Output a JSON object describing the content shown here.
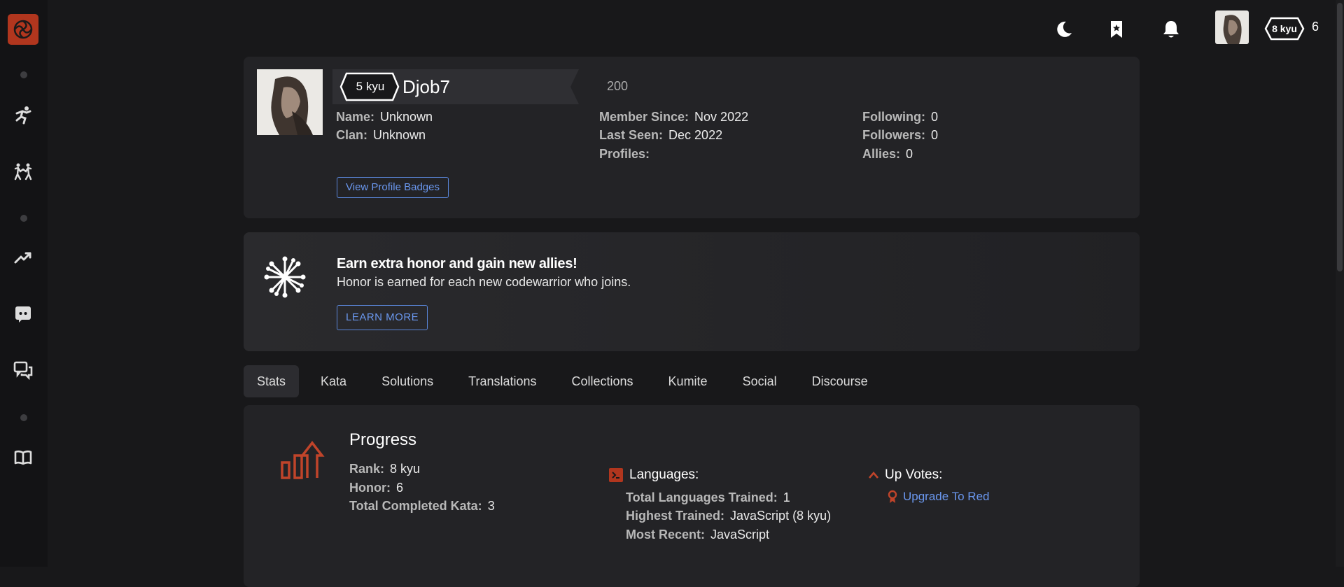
{
  "sidebar": {
    "icons": [
      "codewars-logo-icon",
      "training-icon",
      "practice-icon",
      "leaderboards-icon",
      "discord-icon",
      "discussions-icon",
      "docs-icon"
    ]
  },
  "topbar": {
    "rank": "8 kyu",
    "honor": "6"
  },
  "profile": {
    "rank": "5 kyu",
    "username": "Djob7",
    "honor": "200",
    "col1": [
      {
        "label": "Name:",
        "value": "Unknown"
      },
      {
        "label": "Clan:",
        "value": "Unknown"
      }
    ],
    "col2": [
      {
        "label": "Member Since:",
        "value": "Nov 2022"
      },
      {
        "label": "Last Seen:",
        "value": "Dec 2022"
      },
      {
        "label": "Profiles:",
        "value": ""
      }
    ],
    "col3": [
      {
        "label": "Following:",
        "value": "0"
      },
      {
        "label": "Followers:",
        "value": "0"
      },
      {
        "label": "Allies:",
        "value": "0"
      }
    ],
    "badges_button": "View Profile Badges"
  },
  "referral": {
    "title": "Earn extra honor and gain new allies!",
    "text": "Honor is earned for each new codewarrior who joins.",
    "button": "LEARN MORE"
  },
  "tabs": [
    "Stats",
    "Kata",
    "Solutions",
    "Translations",
    "Collections",
    "Kumite",
    "Social",
    "Discourse"
  ],
  "active_tab": "Stats",
  "progress": {
    "title": "Progress",
    "stats": [
      {
        "label": "Rank:",
        "value": "8 kyu"
      },
      {
        "label": "Honor:",
        "value": "6"
      },
      {
        "label": "Total Completed Kata:",
        "value": "3"
      }
    ],
    "languages": {
      "title": "Languages:",
      "stats": [
        {
          "label": "Total Languages Trained:",
          "value": "1"
        },
        {
          "label": "Highest Trained:",
          "value": "JavaScript (8 kyu)"
        },
        {
          "label": "Most Recent:",
          "value": "JavaScript"
        }
      ]
    },
    "upvotes": {
      "title": "Up Votes:",
      "link": "Upgrade To Red"
    }
  },
  "colors": {
    "accent_red": "#b1361e",
    "link_blue": "#6a97ee",
    "background": "#18181a",
    "card": "#232326"
  }
}
